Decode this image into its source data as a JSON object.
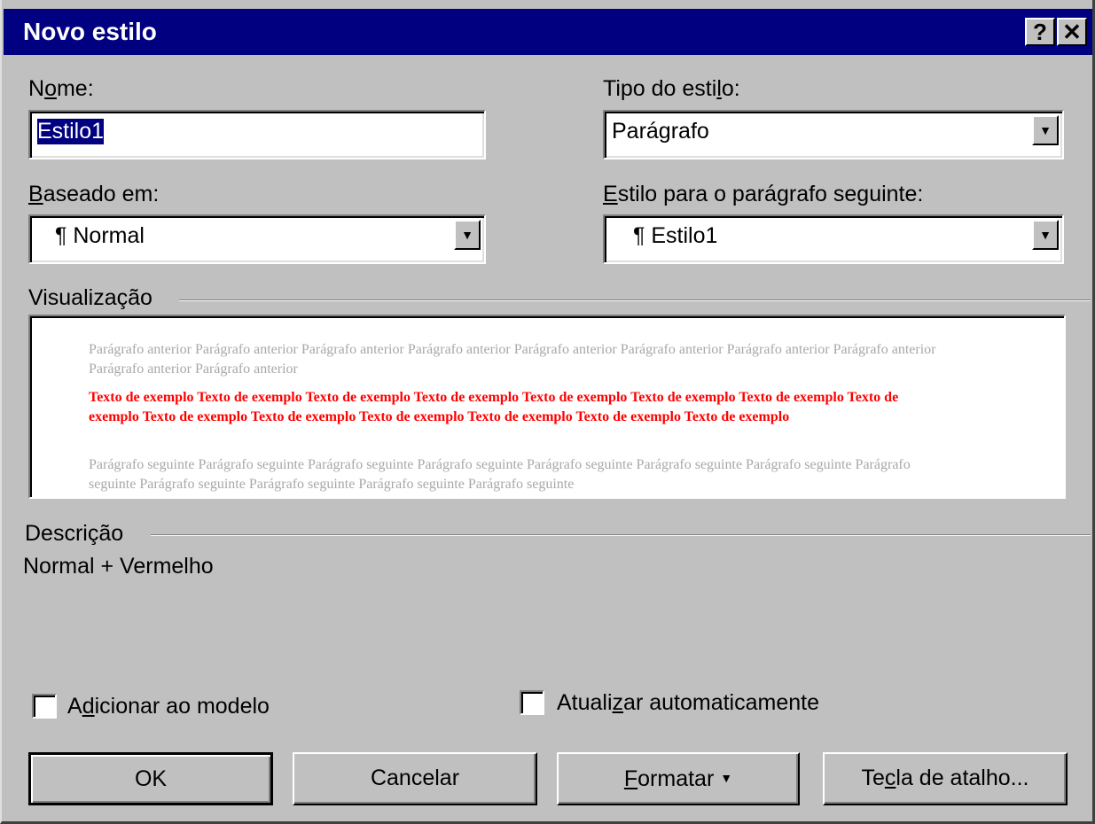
{
  "window": {
    "title": "Novo estilo",
    "help_glyph": "?",
    "close_glyph": "✕"
  },
  "name": {
    "label_pre": "N",
    "label_u": "o",
    "label_post": "me:",
    "value": "Estilo1"
  },
  "style_type": {
    "label_pre": "Tipo do esti",
    "label_u": "l",
    "label_post": "o:",
    "value": "Parágrafo"
  },
  "based_on": {
    "label_u": "B",
    "label_post": "aseado em:",
    "value": "¶ Normal"
  },
  "next_style": {
    "label_u": "E",
    "label_post": "stilo para o parágrafo seguinte:",
    "value": "¶ Estilo1"
  },
  "preview": {
    "label": "Visualização",
    "previous_text": "Parágrafo anterior Parágrafo anterior Parágrafo anterior Parágrafo anterior Parágrafo anterior Parágrafo anterior Parágrafo anterior Parágrafo anterior Parágrafo anterior Parágrafo anterior",
    "sample_text": "Texto de exemplo Texto de exemplo Texto de exemplo Texto de exemplo Texto de exemplo Texto de exemplo Texto de exemplo Texto de exemplo Texto de exemplo Texto de exemplo Texto de exemplo Texto de exemplo Texto de exemplo Texto de exemplo",
    "next_text": "Parágrafo seguinte Parágrafo seguinte Parágrafo seguinte Parágrafo seguinte Parágrafo seguinte Parágrafo seguinte Parágrafo seguinte Parágrafo seguinte Parágrafo seguinte Parágrafo seguinte Parágrafo seguinte Parágrafo seguinte"
  },
  "description": {
    "label": "Descrição",
    "value": "Normal + Vermelho"
  },
  "add_to_template": {
    "label_pre": "A",
    "label_u": "d",
    "label_post": "icionar ao modelo",
    "checked": false
  },
  "auto_update": {
    "label_pre": "Atuali",
    "label_u": "z",
    "label_post": "ar automaticamente",
    "checked": false
  },
  "buttons": {
    "ok": "OK",
    "cancel": "Cancelar",
    "format_u": "F",
    "format_post": "ormatar",
    "format_arrow": "▼",
    "shortcut_pre": "Te",
    "shortcut_u": "c",
    "shortcut_post": "la de atalho..."
  },
  "dropdown_glyph": "▼",
  "colors": {
    "titlebar": "#000080",
    "face": "#c0c0c0",
    "sample_text": "#ff0000",
    "ghost_text": "#a8a8a8"
  }
}
